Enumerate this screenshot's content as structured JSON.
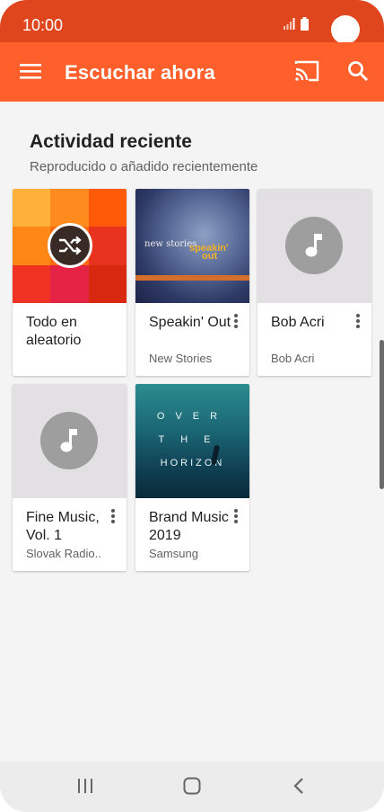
{
  "status_bar": {
    "time": "10:00",
    "color": "#e0461e"
  },
  "app_bar": {
    "title": "Escuchar ahora",
    "color": "#ff5f2b",
    "icons": [
      "menu-icon",
      "cast-icon",
      "search-icon"
    ]
  },
  "section": {
    "title": "Actividad reciente",
    "subtitle": "Reproducido o añadido recientemente"
  },
  "cards": [
    {
      "title": "Todo en aleatorio",
      "subtitle": "",
      "art": "shuffle-mosaic",
      "has_menu": false
    },
    {
      "title": "Speakin' Out",
      "subtitle": "New Stories",
      "art": "album-art",
      "has_menu": true,
      "art_text": {
        "main": "new stories",
        "accent_line1": "speakin'",
        "accent_line2": "out"
      }
    },
    {
      "title": "Bob Acri",
      "subtitle": "Bob Acri",
      "art": "music-note-placeholder",
      "has_menu": true
    },
    {
      "title": "Fine Music, Vol. 1",
      "subtitle": "Slovak Radio..",
      "art": "music-note-placeholder",
      "has_menu": true
    },
    {
      "title": "Brand Music 2019",
      "subtitle": "Samsung",
      "art": "album-art",
      "has_menu": true,
      "art_text": {
        "line1": "OVER",
        "line2": "THE",
        "line3": "HORIZON"
      }
    }
  ],
  "mosaic_colors": [
    "#ffb13b",
    "#ff8a1e",
    "#ff5a08",
    "#ff8716",
    "#ff6a0d",
    "#e8331e",
    "#ef3222",
    "#e52345",
    "#d8280f"
  ],
  "nav_bar": {
    "icons": [
      "recent-apps-icon",
      "home-icon",
      "back-icon"
    ]
  }
}
